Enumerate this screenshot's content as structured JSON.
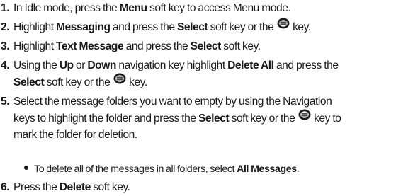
{
  "steps": [
    {
      "num": "1.",
      "lines": [
        [
          {
            "t": "In Idle mode, press the "
          },
          {
            "t": "Menu",
            "b": true
          },
          {
            "t": " soft key to access Menu mode."
          }
        ]
      ]
    },
    {
      "num": "2.",
      "lines": [
        [
          {
            "t": "Highlight "
          },
          {
            "t": "Messaging",
            "b": true
          },
          {
            "t": " and press the "
          },
          {
            "t": "Select",
            "b": true
          },
          {
            "t": " soft key or the "
          },
          {
            "icon": "ok-key-icon"
          },
          {
            "t": " key."
          }
        ]
      ]
    },
    {
      "num": "3.",
      "lines": [
        [
          {
            "t": "Highlight "
          },
          {
            "t": "Text Message",
            "b": true
          },
          {
            "t": " and press the "
          },
          {
            "t": "Select",
            "b": true
          },
          {
            "t": " soft key."
          }
        ]
      ]
    },
    {
      "num": "4.",
      "lines": [
        [
          {
            "t": "Using the "
          },
          {
            "t": "Up",
            "b": true
          },
          {
            "t": " or "
          },
          {
            "t": "Down",
            "b": true
          },
          {
            "t": " navigation key highlight "
          },
          {
            "t": "Delete All",
            "b": true
          },
          {
            "t": " and press the"
          }
        ],
        [
          {
            "t": "Select",
            "b": true
          },
          {
            "t": " soft key or the "
          },
          {
            "icon": "ok-key-icon"
          },
          {
            "t": " key."
          }
        ]
      ]
    },
    {
      "num": "5.",
      "lines": [
        [
          {
            "t": "Select the message folders you want to empty by using the Navigation"
          }
        ],
        [
          {
            "t": "keys to highlight the folder and press the "
          },
          {
            "t": "Select",
            "b": true
          },
          {
            "t": " soft key or the "
          },
          {
            "icon": "ok-key-icon"
          },
          {
            "t": " key to"
          }
        ],
        [
          {
            "t": "mark the folder for deletion."
          }
        ]
      ]
    },
    {
      "num": "6.",
      "lines": [
        [
          {
            "t": "Press the "
          },
          {
            "t": "Delete",
            "b": true
          },
          {
            "t": " soft key."
          }
        ]
      ]
    }
  ],
  "sub_bullet": [
    {
      "t": "To delete all of the messages in all folders, select "
    },
    {
      "t": "All Messages",
      "b": true
    },
    {
      "t": "."
    }
  ]
}
